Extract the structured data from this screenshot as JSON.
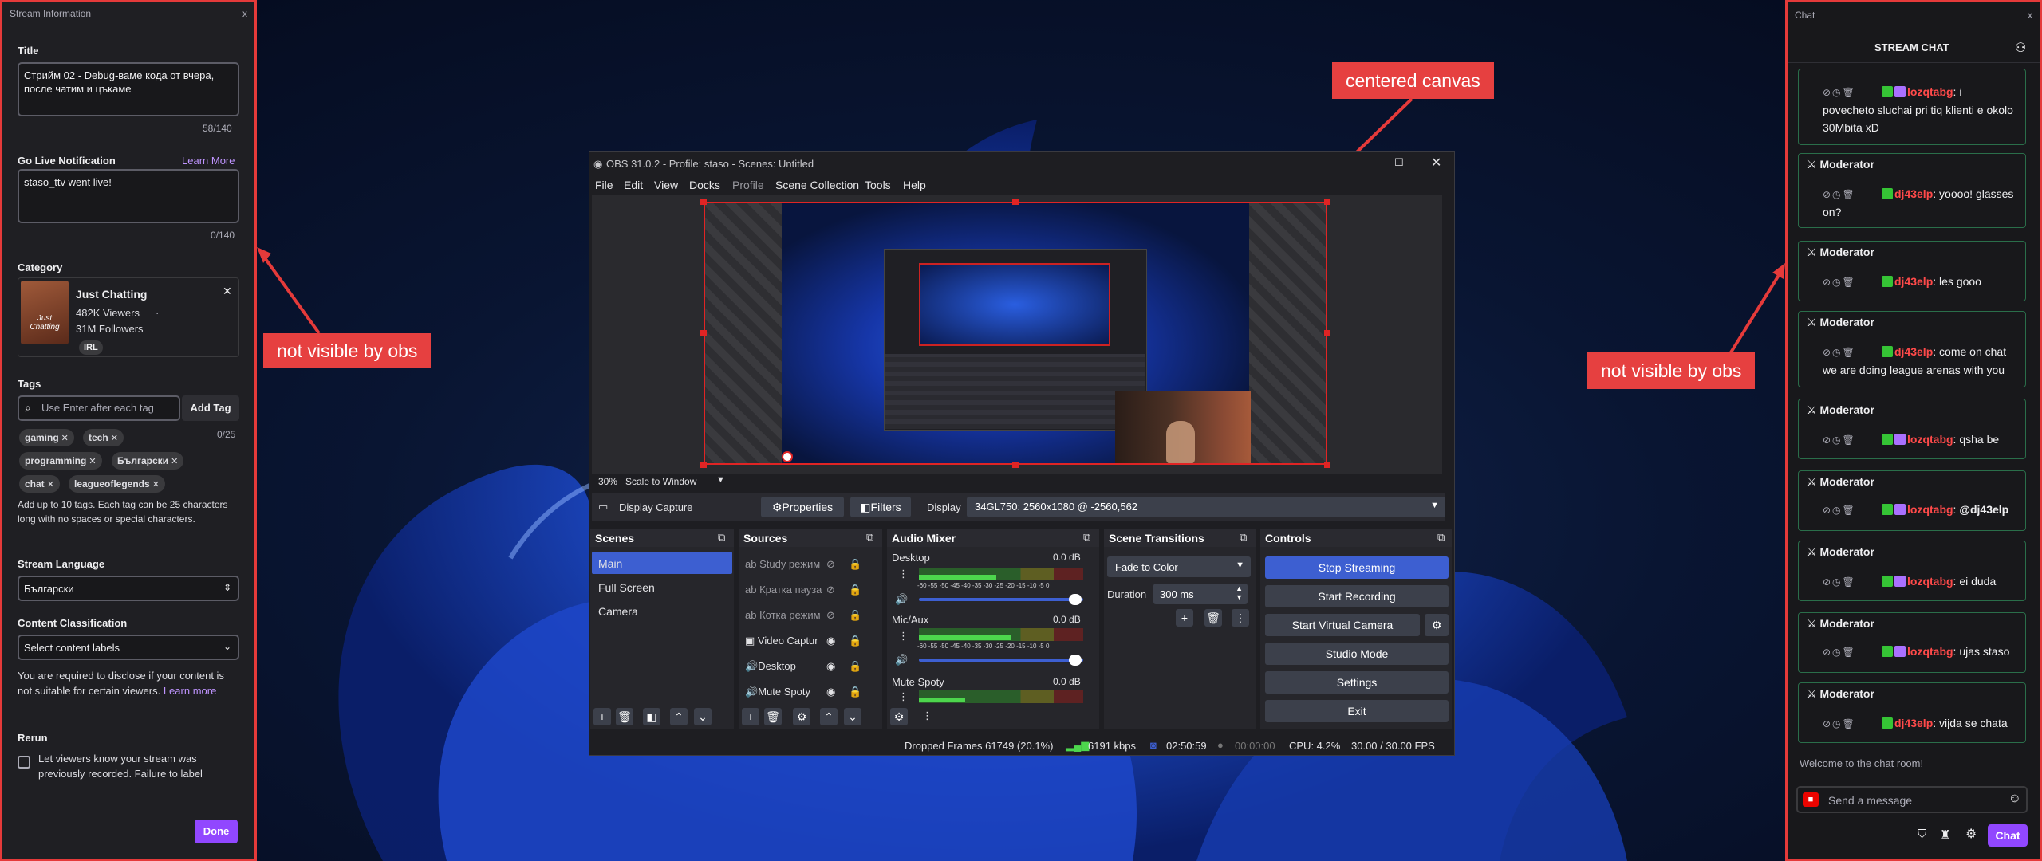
{
  "stream_info": {
    "panel_title": "Stream Information",
    "close": "x",
    "title_label": "Title",
    "title_value": "Стрийм 02 - Debug-ваме кода от вчера, после чатим и цъкаме",
    "title_count": "58/140",
    "notification_label": "Go Live Notification",
    "learn_more": "Learn More",
    "notification_value": "staso_ttv went live!",
    "notification_count": "0/140",
    "category_label": "Category",
    "category_name": "Just Chatting",
    "category_viewers": "482K Viewers",
    "category_followers": "31M Followers",
    "category_tag": "IRL",
    "category_thumb_text": "Just Chatting",
    "category_remove": "✕",
    "tags_label": "Tags",
    "tags_placeholder": "Use Enter after each tag",
    "add_tag": "Add Tag",
    "tags_count": "0/25",
    "tags": [
      "gaming",
      "tech",
      "programming",
      "Български",
      "chat",
      "leagueoflegends"
    ],
    "tags_help": "Add up to 10 tags. Each tag can be 25 characters long with no spaces or special characters.",
    "language_label": "Stream Language",
    "language_value": "Български",
    "classification_label": "Content Classification",
    "classification_value": "Select content labels",
    "classification_help": "You are required to disclose if your content is not suitable for certain viewers.",
    "classification_learn": "Learn more",
    "rerun_label": "Rerun",
    "rerun_text": "Let viewers know your stream was previously recorded. Failure to label",
    "done": "Done"
  },
  "callouts": {
    "left": "not visible by obs",
    "center": "centered canvas",
    "right": "not visible by obs"
  },
  "obs": {
    "title": "OBS 31.0.2 - Profile: staso - Scenes: Untitled",
    "menu": [
      "File",
      "Edit",
      "View",
      "Docks",
      "Profile",
      "Scene Collection",
      "Tools",
      "Help"
    ],
    "zoom": "30%",
    "scale_mode": "Scale to Window",
    "source_name": "Display Capture",
    "properties": "Properties",
    "filters": "Filters",
    "display_label": "Display",
    "display_value": "34GL750: 2560x1080 @ -2560,562",
    "docks": {
      "scenes": "Scenes",
      "sources": "Sources",
      "audio": "Audio Mixer",
      "transitions": "Scene Transitions",
      "controls": "Controls"
    },
    "scenes": [
      "Main",
      "Full Screen",
      "Camera"
    ],
    "sources": [
      "Study режим",
      "Кратка пауза",
      "Котка режим",
      "Video Captur",
      "Desktop",
      "Mute Spoty"
    ],
    "mixer": [
      {
        "name": "Desktop",
        "db": "0.0 dB",
        "level": 0.47
      },
      {
        "name": "Mic/Aux",
        "db": "0.0 dB",
        "level": 0.56
      },
      {
        "name": "Mute Spoty",
        "db": "0.0 dB",
        "level": 0.28
      }
    ],
    "meter_scale": "-60 -55 -50 -45 -40 -35 -30 -25 -20 -15 -10 -5 0",
    "transition": "Fade to Color",
    "duration_label": "Duration",
    "duration_value": "300 ms",
    "controls": [
      "Stop Streaming",
      "Start Recording",
      "Start Virtual Camera",
      "Studio Mode",
      "Settings",
      "Exit"
    ],
    "status": {
      "dropped": "Dropped Frames 61749 (20.1%)",
      "kbps": "6191 kbps",
      "live_time": "02:50:59",
      "rec_time": "00:00:00",
      "cpu": "CPU: 4.2%",
      "fps": "30.00 / 30.00 FPS"
    },
    "accent": "#3d5fd1"
  },
  "chat": {
    "panel_title": "Chat",
    "close": "x",
    "header": "STREAM CHAT",
    "moderator_label": "Moderator",
    "messages": [
      {
        "user": "lozqtabg",
        "text": "i povecheto sluchai pri tiq klienti e okolo 30Mbita xD"
      },
      {
        "user": "dj43elp",
        "text": "yoooo! glasses on?"
      },
      {
        "user": "dj43elp",
        "text": "les gooo"
      },
      {
        "user": "dj43elp",
        "text": "come on chat we are doing league arenas with you"
      },
      {
        "user": "lozqtabg",
        "text": "qsha be"
      },
      {
        "user": "lozqtabg",
        "text": "@dj43elp"
      },
      {
        "user": "lozqtabg",
        "text": "ei duda"
      },
      {
        "user": "lozqtabg",
        "text": "ujas staso"
      },
      {
        "user": "dj43elp",
        "text": "vijda se chata"
      }
    ],
    "welcome": "Welcome to the chat room!",
    "input_placeholder": "Send a message",
    "send": "Chat"
  }
}
